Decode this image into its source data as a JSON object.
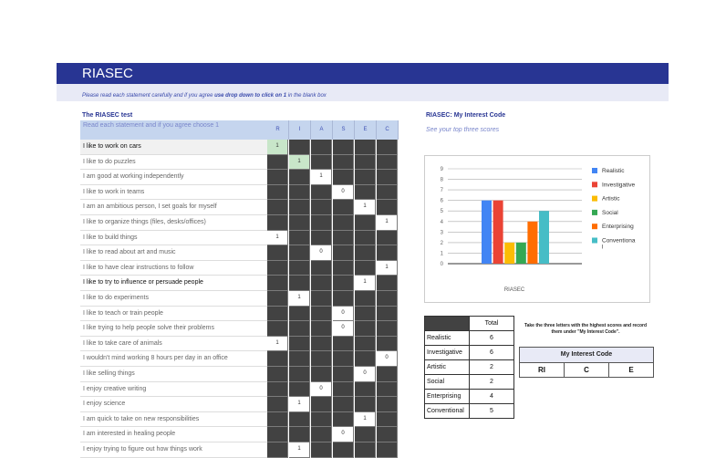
{
  "title": "RIASEC",
  "instructions": {
    "pre": "Please read each statement carefully and if you agree ",
    "bold": "use drop down to click on 1",
    "post": " in the blank box"
  },
  "test_title": "The RIASEC test",
  "header_instr": "Read each statement and if you agree choose 1",
  "columns": [
    "R",
    "I",
    "A",
    "S",
    "E",
    "C"
  ],
  "rows": [
    {
      "text": "I like to work on cars",
      "col": 0,
      "val": "1",
      "style": "sel"
    },
    {
      "text": "I like to do puzzles",
      "col": 1,
      "val": "1",
      "style": "green"
    },
    {
      "text": "I am good at working independently",
      "col": 2,
      "val": "1",
      "style": ""
    },
    {
      "text": "I like to work in teams",
      "col": 3,
      "val": "0",
      "style": ""
    },
    {
      "text": "I am an ambitious person, I set goals for myself",
      "col": 4,
      "val": "1",
      "style": ""
    },
    {
      "text": "I like to organize things (files, desks/offices)",
      "col": 5,
      "val": "1",
      "style": ""
    },
    {
      "text": "I like to build things",
      "col": 0,
      "val": "1",
      "style": ""
    },
    {
      "text": "I like to read about art and music",
      "col": 2,
      "val": "0",
      "style": ""
    },
    {
      "text": "I like to have clear instructions to follow",
      "col": 5,
      "val": "1",
      "style": ""
    },
    {
      "text": "I like to try to influence or persuade people",
      "col": 4,
      "val": "1",
      "style": "dark"
    },
    {
      "text": "I like to do experiments",
      "col": 1,
      "val": "1",
      "style": ""
    },
    {
      "text": "I like to teach or train people",
      "col": 3,
      "val": "0",
      "style": ""
    },
    {
      "text": "I like trying to help people solve their problems",
      "col": 3,
      "val": "0",
      "style": ""
    },
    {
      "text": "I like to take care of animals",
      "col": 0,
      "val": "1",
      "style": ""
    },
    {
      "text": "I wouldn't mind working 8 hours per day in an office",
      "col": 5,
      "val": "0",
      "style": ""
    },
    {
      "text": "I like selling things",
      "col": 4,
      "val": "0",
      "style": ""
    },
    {
      "text": "I enjoy creative writing",
      "col": 2,
      "val": "0",
      "style": ""
    },
    {
      "text": "I enjoy science",
      "col": 1,
      "val": "1",
      "style": ""
    },
    {
      "text": "I am quick to take on new responsibilities",
      "col": 4,
      "val": "1",
      "style": ""
    },
    {
      "text": "I am interested in healing people",
      "col": 3,
      "val": "0",
      "style": ""
    },
    {
      "text": "I enjoy trying to figure out how things work",
      "col": 1,
      "val": "1",
      "style": ""
    }
  ],
  "interest_title": "RIASEC: My Interest Code",
  "interest_sub": "See your top three scores",
  "chart_data": {
    "type": "bar",
    "xlabel": "RIASEC",
    "ylim": [
      0,
      9
    ],
    "yticks": [
      0,
      1,
      2,
      3,
      4,
      5,
      6,
      7,
      8,
      9
    ],
    "grid": true,
    "legend_position": "right",
    "series": [
      {
        "name": "Realistic",
        "value": 6,
        "color": "#4285f4"
      },
      {
        "name": "Investigative",
        "value": 6,
        "color": "#ea4335"
      },
      {
        "name": "Artistic",
        "value": 2,
        "color": "#fbbc04"
      },
      {
        "name": "Social",
        "value": 2,
        "color": "#34a853"
      },
      {
        "name": "Enterprising",
        "value": 4,
        "color": "#ff6d01"
      },
      {
        "name": "Conventional",
        "value": 5,
        "color": "#46bdc6"
      }
    ]
  },
  "totals": {
    "header": "Total",
    "rows": [
      {
        "label": "Realistic",
        "value": "6"
      },
      {
        "label": "Investigative",
        "value": "6"
      },
      {
        "label": "Artistic",
        "value": "2"
      },
      {
        "label": "Social",
        "value": "2"
      },
      {
        "label": "Enterprising",
        "value": "4"
      },
      {
        "label": "Conventional",
        "value": "5"
      }
    ]
  },
  "code_instructions": "Take the three letters with the highest scores and record them under \"My Interest Code\".",
  "code_title": "My Interest Code",
  "codes": [
    "RI",
    "C",
    "E"
  ]
}
